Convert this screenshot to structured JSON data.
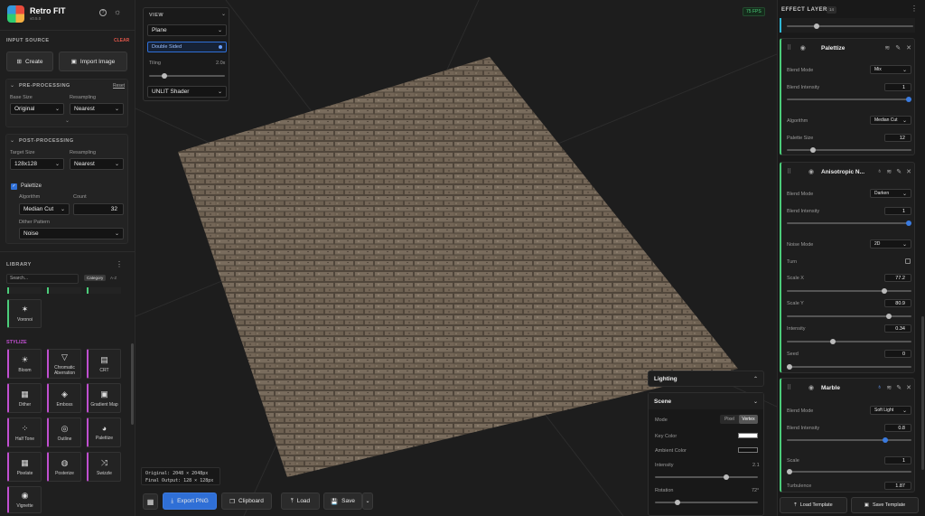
{
  "app": {
    "title": "Retro FIT",
    "version": "v0.5.0"
  },
  "input_source": {
    "label": "INPUT SOURCE",
    "clear": "CLEAR",
    "create": "Create",
    "import": "Import Image"
  },
  "pre": {
    "title": "PRE-PROCESSING",
    "reset": "Reset",
    "base_size_label": "Base Size",
    "base_size": "Original",
    "resampling_label": "Resampling",
    "resampling": "Nearest"
  },
  "post": {
    "title": "POST-PROCESSING",
    "target_size_label": "Target Size",
    "target_size": "128x128",
    "resampling_label": "Resampling",
    "resampling": "Nearest",
    "palettize_label": "Palettize",
    "algorithm_label": "Algorithm",
    "algorithm": "Median Cut",
    "count_label": "Count",
    "count": "32",
    "dither_label": "Dither Pattern",
    "dither": "Noise"
  },
  "library": {
    "title": "LIBRARY",
    "search_placeholder": "Search...",
    "category": "Category",
    "az": "A-Z",
    "voronoi": "Voronoi",
    "stylize": "STYLIZE",
    "tiles": [
      "Bloom",
      "Chromatic Aberration",
      "CRT",
      "Dither",
      "Emboss",
      "Gradient Map",
      "Half Tone",
      "Outline",
      "Palettize",
      "Pixelate",
      "Posterize",
      "Swizzle",
      "Vignette"
    ]
  },
  "view": {
    "title": "VIEW",
    "shape": "Plane",
    "double_sided": "Double Sided",
    "tiling_label": "Tiling",
    "tiling_value": "2.0x",
    "tiling_fraction": 0.1,
    "shader": "UNLIT Shader"
  },
  "fps": "75 FPS",
  "info": {
    "original": "Original: 2048 × 2048px",
    "final": "Final Output: 128 × 128px"
  },
  "toolbar": {
    "export": "Export PNG",
    "clipboard": "Clipboard",
    "load": "Load",
    "save": "Save"
  },
  "lighting": {
    "title": "Lighting"
  },
  "scene": {
    "title": "Scene",
    "mode_label": "Mode",
    "pixel": "Pixel",
    "vertex": "Vertex",
    "key_color_label": "Key Color",
    "ambient_label": "Ambient Color",
    "intensity_label": "Intensity",
    "intensity": "2.1",
    "rotation_label": "Rotation",
    "rotation": "72°"
  },
  "effect_layers": {
    "title": "EFFECT LAYERS",
    "count": "14",
    "palettize": {
      "name": "Palettize",
      "blend_mode_label": "Blend Mode",
      "blend_mode": "Mix",
      "blend_intensity_label": "Blend Intensity",
      "blend_intensity": "1",
      "algorithm_label": "Algorithm",
      "algorithm": "Median Cut",
      "palette_size_label": "Palette Size",
      "palette_size": "12"
    },
    "aniso": {
      "name": "Anisotropic N...",
      "blend_mode_label": "Blend Mode",
      "blend_mode": "Darken",
      "blend_intensity_label": "Blend Intensity",
      "blend_intensity": "1",
      "noise_mode_label": "Noise Mode",
      "noise_mode": "2D",
      "turn_label": "Turn",
      "scale_x_label": "Scale X",
      "scale_x": "77.2",
      "scale_y_label": "Scale Y",
      "scale_y": "80.9",
      "intensity_label": "Intensity",
      "intensity": "0.34",
      "seed_label": "Seed",
      "seed": "0"
    },
    "marble": {
      "name": "Marble",
      "blend_mode_label": "Blend Mode",
      "blend_mode": "Soft Light",
      "blend_intensity_label": "Blend Intensity",
      "blend_intensity": "0.8",
      "scale_label": "Scale",
      "scale": "1",
      "turbulence_label": "Turbulence",
      "turbulence": "1.87"
    },
    "load_template": "Load Template",
    "save_template": "Save Template"
  },
  "colors": {
    "accent": "#2f6fd6",
    "stylize": "#c04fd0",
    "green": "#4ccd7a",
    "clear": "#e0564a"
  }
}
